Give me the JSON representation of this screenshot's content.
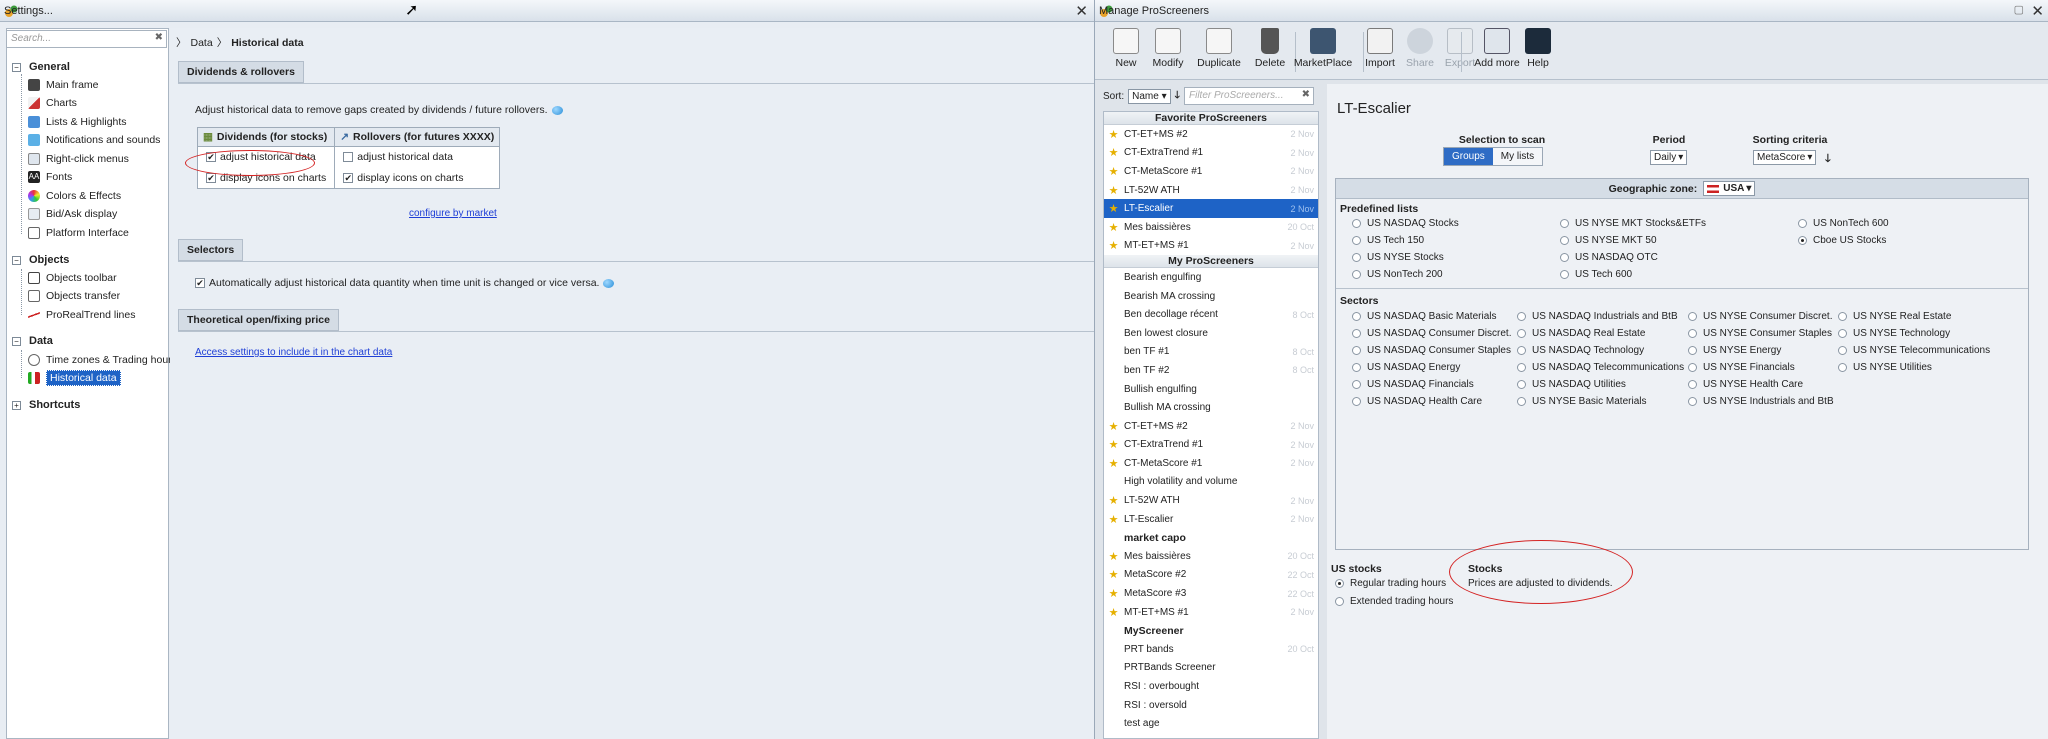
{
  "left_window": {
    "title": "Settings...",
    "search_placeholder": "Search...",
    "tree": {
      "general": {
        "label": "General",
        "items": [
          "Main frame",
          "Charts",
          "Lists & Highlights",
          "Notifications and sounds",
          "Right-click menus",
          "Fonts",
          "Colors & Effects",
          "Bid/Ask display",
          "Platform Interface"
        ]
      },
      "objects": {
        "label": "Objects",
        "items": [
          "Objects toolbar",
          "Objects transfer",
          "ProRealTrend lines"
        ]
      },
      "data": {
        "label": "Data",
        "items": [
          "Time zones & Trading hours",
          "Historical data"
        ]
      },
      "shortcuts": {
        "label": "Shortcuts"
      }
    },
    "breadcrumb": {
      "root": "Data",
      "current": "Historical data"
    },
    "dividends": {
      "header": "Dividends & rollovers",
      "description": "Adjust historical data to remove gaps created by dividends / future rollovers.",
      "col1": "Dividends (for stocks)",
      "col2": "Rollovers (for futures XXXX)",
      "adjust": "adjust historical data",
      "display": "display icons on charts",
      "configure": "configure by market"
    },
    "selectors": {
      "header": "Selectors",
      "auto": "Automatically adjust historical data quantity when time unit is changed or vice versa."
    },
    "theoretical": {
      "header": "Theoretical open/fixing price",
      "link": "Access settings to include it in the chart data"
    }
  },
  "right_window": {
    "title": "Manage ProScreeners",
    "toolbar": [
      "New",
      "Modify",
      "Duplicate",
      "Delete",
      "MarketPlace",
      "Import",
      "Share",
      "Export",
      "Add more",
      "Help"
    ],
    "sort_label": "Sort:",
    "sort_value": "Name",
    "filter_placeholder": "Filter ProScreeners...",
    "favorites_header": "Favorite ProScreeners",
    "favorites": [
      {
        "name": "CT-ET+MS #2",
        "date": "2 Nov",
        "star": true
      },
      {
        "name": "CT-ExtraTrend #1",
        "date": "2 Nov",
        "star": true
      },
      {
        "name": "CT-MetaScore #1",
        "date": "2 Nov",
        "star": true
      },
      {
        "name": "LT-52W ATH",
        "date": "2 Nov",
        "star": true
      },
      {
        "name": "LT-Escalier",
        "date": "2 Nov",
        "star": true,
        "selected": true
      },
      {
        "name": "Mes baissières",
        "date": "20 Oct",
        "star": true
      },
      {
        "name": "MT-ET+MS #1",
        "date": "2 Nov",
        "star": true
      }
    ],
    "my_header": "My ProScreeners",
    "my": [
      {
        "name": "Bearish engulfing",
        "date": "",
        "star": false
      },
      {
        "name": "Bearish MA crossing",
        "date": "",
        "star": false
      },
      {
        "name": "Ben decollage récent",
        "date": "8 Oct",
        "star": false
      },
      {
        "name": "Ben lowest closure",
        "date": "",
        "star": false
      },
      {
        "name": "ben TF #1",
        "date": "8 Oct",
        "star": false
      },
      {
        "name": "ben TF #2",
        "date": "8 Oct",
        "star": false
      },
      {
        "name": "Bullish engulfing",
        "date": "",
        "star": false
      },
      {
        "name": "Bullish MA crossing",
        "date": "",
        "star": false
      },
      {
        "name": "CT-ET+MS #2",
        "date": "2 Nov",
        "star": true
      },
      {
        "name": "CT-ExtraTrend #1",
        "date": "2 Nov",
        "star": true
      },
      {
        "name": "CT-MetaScore #1",
        "date": "2 Nov",
        "star": true
      },
      {
        "name": "High volatility and volume",
        "date": "",
        "star": false
      },
      {
        "name": "LT-52W ATH",
        "date": "2 Nov",
        "star": true
      },
      {
        "name": "LT-Escalier",
        "date": "2 Nov",
        "star": true
      },
      {
        "name": "market capo",
        "date": "",
        "star": false,
        "bold": true
      },
      {
        "name": "Mes baissières",
        "date": "20 Oct",
        "star": true
      },
      {
        "name": "MetaScore #2",
        "date": "22 Oct",
        "star": true
      },
      {
        "name": "MetaScore #3",
        "date": "22 Oct",
        "star": true
      },
      {
        "name": "MT-ET+MS #1",
        "date": "2 Nov",
        "star": true
      },
      {
        "name": "MyScreener",
        "date": "",
        "star": false,
        "bold": true
      },
      {
        "name": "PRT bands",
        "date": "20 Oct",
        "star": false
      },
      {
        "name": "PRTBands Screener",
        "date": "",
        "star": false
      },
      {
        "name": "RSI : overbought",
        "date": "",
        "star": false
      },
      {
        "name": "RSI : oversold",
        "date": "",
        "star": false
      },
      {
        "name": "test age",
        "date": "",
        "star": false
      }
    ],
    "screener_title": "LT-Escalier",
    "selection_label": "Selection to scan",
    "groups": "Groups",
    "mylists": "My lists",
    "period_label": "Period",
    "period_value": "Daily",
    "sorting_label": "Sorting criteria",
    "sorting_value": "MetaScore",
    "geo_label": "Geographic zone:",
    "geo_value": "USA",
    "predefined_label": "Predefined lists",
    "predefined": [
      [
        "US NASDAQ Stocks",
        "US Tech 150",
        "US NYSE Stocks",
        "US NonTech 200"
      ],
      [
        "US NYSE MKT Stocks&ETFs",
        "US NYSE MKT 50",
        "US NASDAQ OTC",
        "US Tech 600"
      ],
      [
        "US NonTech 600",
        "Cboe US Stocks"
      ]
    ],
    "predefined_selected": "Cboe US Stocks",
    "sectors_label": "Sectors",
    "sectors": [
      [
        "US NASDAQ Basic Materials",
        "US NASDAQ Consumer Discret.",
        "US NASDAQ Consumer Staples",
        "US NASDAQ Energy",
        "US NASDAQ Financials",
        "US NASDAQ Health Care"
      ],
      [
        "US NASDAQ Industrials and BtB",
        "US NASDAQ Real Estate",
        "US NASDAQ Technology",
        "US NASDAQ Telecommunications",
        "US NASDAQ Utilities",
        "US NYSE Basic Materials"
      ],
      [
        "US NYSE Consumer Discret.",
        "US NYSE Consumer Staples",
        "US NYSE Energy",
        "US NYSE Financials",
        "US NYSE Health Care",
        "US NYSE Industrials and BtB"
      ],
      [
        "US NYSE Real Estate",
        "US NYSE Technology",
        "US NYSE Telecommunications",
        "US NYSE Utilities"
      ]
    ],
    "us_stocks_label": "US stocks",
    "regular": "Regular trading hours",
    "extended": "Extended trading hours",
    "stocks_label": "Stocks",
    "stocks_note": "Prices are adjusted to dividends."
  }
}
